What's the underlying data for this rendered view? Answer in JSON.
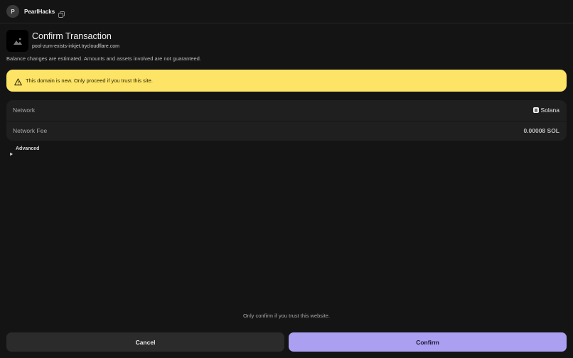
{
  "header": {
    "avatar_initial": "P",
    "account_name": "PearlHacks",
    "copy_icon": "copy-icon"
  },
  "request": {
    "title": "Confirm Transaction",
    "domain": "pool-zum-exists-inkjet.trycloudflare.com",
    "site_icon": "image-placeholder-icon",
    "disclaimer": "Balance changes are estimated. Amounts and assets involved are not guaranteed."
  },
  "warning": {
    "text": "This domain is new. Only proceed if you trust this site.",
    "icon": "warning-triangle-icon",
    "color": "#fde466"
  },
  "details": {
    "network_label": "Network",
    "network_value": "Solana",
    "network_icon": "solana-icon",
    "fee_label": "Network Fee",
    "fee_value": "0.00008 SOL"
  },
  "advanced": {
    "label": "Advanced",
    "icon": "caret-right-icon"
  },
  "footer": {
    "note": "Only confirm if you trust this website.",
    "cancel_label": "Cancel",
    "confirm_label": "Confirm",
    "confirm_color": "#ab9ff2"
  }
}
